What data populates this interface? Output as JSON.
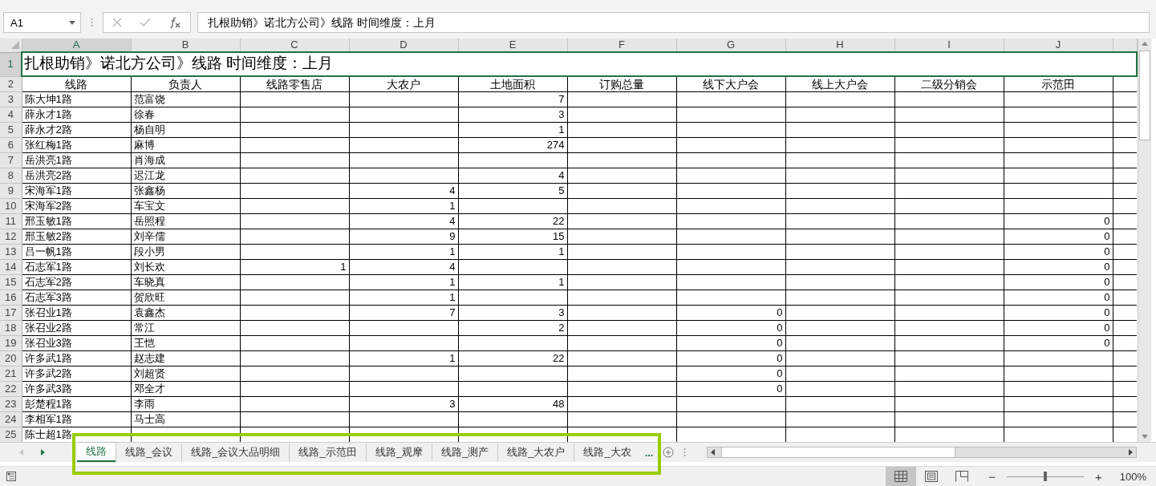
{
  "name_box": {
    "value": "A1"
  },
  "formula_bar": {
    "value": "扎根助销》诺北方公司》线路  时间维度：上月"
  },
  "columns": [
    {
      "label": "A",
      "selected": true
    },
    {
      "label": "B",
      "selected": false
    },
    {
      "label": "C",
      "selected": false
    },
    {
      "label": "D",
      "selected": false
    },
    {
      "label": "E",
      "selected": false
    },
    {
      "label": "F",
      "selected": false
    },
    {
      "label": "G",
      "selected": false
    },
    {
      "label": "H",
      "selected": false
    },
    {
      "label": "I",
      "selected": false
    },
    {
      "label": "J",
      "selected": false
    }
  ],
  "title_row": {
    "row": "1",
    "selected": true,
    "text": "扎根助销》诺北方公司》线路  时间维度：上月"
  },
  "header_row": {
    "row": "2",
    "selected": false,
    "cells": [
      "线路",
      "负责人",
      "线路零售店",
      "大农户",
      "土地面积",
      "订购总量",
      "线下大户会",
      "线上大户会",
      "二级分销会",
      "示范田"
    ]
  },
  "rows": [
    {
      "row": "3",
      "selected": false,
      "route": "陈大坤1路",
      "owner": "范富饶",
      "values": {
        "E": "7"
      }
    },
    {
      "row": "4",
      "selected": false,
      "route": "薛永才1路",
      "owner": "徐春",
      "values": {
        "E": "3"
      }
    },
    {
      "row": "5",
      "selected": false,
      "route": "薛永才2路",
      "owner": "杨自明",
      "values": {
        "E": "1"
      }
    },
    {
      "row": "6",
      "selected": false,
      "route": "张红梅1路",
      "owner": "麻博",
      "values": {
        "E": "274"
      }
    },
    {
      "row": "7",
      "selected": false,
      "route": "岳洪亮1路",
      "owner": "肖海成",
      "values": {}
    },
    {
      "row": "8",
      "selected": false,
      "route": "岳洪亮2路",
      "owner": "迟江龙",
      "values": {
        "E": "4"
      }
    },
    {
      "row": "9",
      "selected": false,
      "route": "宋海军1路",
      "owner": "张鑫杨",
      "values": {
        "D": "4",
        "E": "5"
      }
    },
    {
      "row": "10",
      "selected": false,
      "route": "宋海军2路",
      "owner": "车宝文",
      "values": {
        "D": "1"
      }
    },
    {
      "row": "11",
      "selected": false,
      "route": "邢玉敏1路",
      "owner": "岳照程",
      "values": {
        "D": "4",
        "E": "22",
        "J": "0"
      }
    },
    {
      "row": "12",
      "selected": false,
      "route": "邢玉敏2路",
      "owner": "刘辛儒",
      "values": {
        "D": "9",
        "E": "15",
        "J": "0"
      }
    },
    {
      "row": "13",
      "selected": false,
      "route": "吕一帆1路",
      "owner": "段小男",
      "values": {
        "D": "1",
        "E": "1",
        "J": "0"
      }
    },
    {
      "row": "14",
      "selected": false,
      "route": "石志军1路",
      "owner": "刘长欢",
      "values": {
        "C": "1",
        "D": "4",
        "J": "0"
      }
    },
    {
      "row": "15",
      "selected": false,
      "route": "石志军2路",
      "owner": "车晓真",
      "values": {
        "D": "1",
        "E": "1",
        "J": "0"
      }
    },
    {
      "row": "16",
      "selected": false,
      "route": "石志军3路",
      "owner": "贺欣旺",
      "values": {
        "D": "1",
        "J": "0"
      }
    },
    {
      "row": "17",
      "selected": false,
      "route": "张召业1路",
      "owner": "袁鑫杰",
      "values": {
        "D": "7",
        "E": "3",
        "G": "0",
        "J": "0"
      }
    },
    {
      "row": "18",
      "selected": false,
      "route": "张召业2路",
      "owner": "常江",
      "values": {
        "E": "2",
        "G": "0",
        "J": "0"
      }
    },
    {
      "row": "19",
      "selected": false,
      "route": "张召业3路",
      "owner": "王恺",
      "values": {
        "G": "0",
        "J": "0"
      }
    },
    {
      "row": "20",
      "selected": false,
      "route": "许多武1路",
      "owner": "赵志建",
      "values": {
        "D": "1",
        "E": "22",
        "G": "0"
      }
    },
    {
      "row": "21",
      "selected": false,
      "route": "许多武2路",
      "owner": "刘超贤",
      "values": {
        "G": "0"
      }
    },
    {
      "row": "22",
      "selected": false,
      "route": "许多武3路",
      "owner": "邓全才",
      "values": {
        "G": "0"
      }
    },
    {
      "row": "23",
      "selected": false,
      "route": "彭楚程1路",
      "owner": "李雨",
      "values": {
        "D": "3",
        "E": "48"
      }
    },
    {
      "row": "24",
      "selected": false,
      "route": "李相军1路",
      "owner": "马士高",
      "values": {}
    },
    {
      "row": "25",
      "selected": false,
      "route": "陈士超1路",
      "values": {}
    }
  ],
  "sheet_tabs": [
    {
      "label": "线路",
      "selected": true
    },
    {
      "label": "线路_会议",
      "selected": false
    },
    {
      "label": "线路_会议大品明细",
      "selected": false
    },
    {
      "label": "线路_示范田",
      "selected": false
    },
    {
      "label": "线路_观摩",
      "selected": false
    },
    {
      "label": "线路_测产",
      "selected": false
    },
    {
      "label": "线路_大农户",
      "selected": false
    },
    {
      "label": "线路_大农",
      "selected": false
    }
  ],
  "more_tabs": "...",
  "view_buttons": [
    {
      "kind": "normal",
      "selected": true
    },
    {
      "kind": "page-layout",
      "selected": false
    },
    {
      "kind": "page-break",
      "selected": false
    }
  ],
  "zoom": {
    "minus": "−",
    "plus": "+",
    "level": 0.5,
    "value": "100%"
  }
}
